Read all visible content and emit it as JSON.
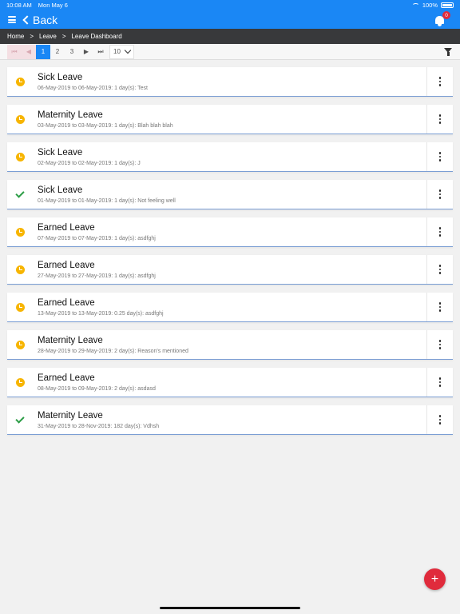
{
  "status_bar": {
    "time": "10:08 AM",
    "date": "Mon May 6",
    "battery": "100%"
  },
  "app_bar": {
    "back_label": "Back",
    "notification_count": "0"
  },
  "breadcrumb": [
    "Home",
    "Leave",
    "Leave Dashboard"
  ],
  "pager": {
    "pages": [
      "1",
      "2",
      "3"
    ],
    "current": "1",
    "page_size": "10"
  },
  "leaves": [
    {
      "type": "Sick Leave",
      "details": "06-May-2019 to 06-May-2019: 1 day(s): Test",
      "status": "pending"
    },
    {
      "type": "Maternity Leave",
      "details": "03-May-2019 to 03-May-2019: 1 day(s): Blah blah blah",
      "status": "pending"
    },
    {
      "type": "Sick Leave",
      "details": "02-May-2019 to 02-May-2019: 1 day(s): J",
      "status": "pending"
    },
    {
      "type": "Sick Leave",
      "details": "01-May-2019 to 01-May-2019: 1 day(s): Not feeling well",
      "status": "approved"
    },
    {
      "type": "Earned Leave",
      "details": "07-May-2019 to 07-May-2019: 1 day(s): asdfghj",
      "status": "pending"
    },
    {
      "type": "Earned Leave",
      "details": "27-May-2019 to 27-May-2019: 1 day(s): asdfghj",
      "status": "pending"
    },
    {
      "type": "Earned Leave",
      "details": "13-May-2019 to 13-May-2019: 0.25 day(s): asdfghj",
      "status": "pending"
    },
    {
      "type": "Maternity Leave",
      "details": "28-May-2019 to 29-May-2019: 2 day(s): Reason's mentioned",
      "status": "pending"
    },
    {
      "type": "Earned Leave",
      "details": "08-May-2019 to 09-May-2019: 2 day(s): asdasd",
      "status": "pending"
    },
    {
      "type": "Maternity Leave",
      "details": "31-May-2019 to 28-Nov-2019: 182 day(s): Vdhsh",
      "status": "approved"
    }
  ],
  "fab_label": "+",
  "colors": {
    "primary": "#1a87f5",
    "pending": "#f7b500",
    "approved": "#2c9d46",
    "accent": "#e02b3c",
    "breadcrumb_bg": "#38393b"
  }
}
